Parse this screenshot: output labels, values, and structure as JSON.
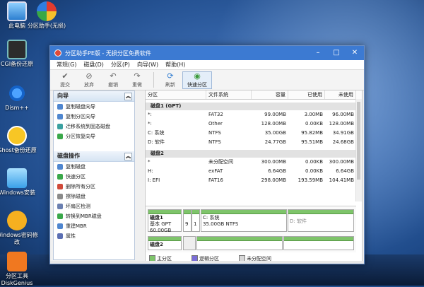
{
  "desktop": {
    "icons": [
      {
        "label": "此电脑",
        "icon": "computer-icon"
      },
      {
        "label": "分区助手(无损)",
        "icon": "partition-assistant-icon"
      },
      {
        "label": "CGI备份还原",
        "icon": "cgi-backup-icon"
      },
      {
        "label": "Dism++",
        "icon": "dism-icon"
      },
      {
        "label": "Ghost备份还原",
        "icon": "ghost-icon"
      },
      {
        "label": "Windows安装",
        "icon": "windows-install-icon"
      },
      {
        "label": "Windows密码修改",
        "icon": "windows-password-icon"
      },
      {
        "label": "分区工具DiskGenius",
        "icon": "diskgenius-icon"
      }
    ]
  },
  "window": {
    "title": "分区助手PE版 - 无损分区免费软件",
    "menu": [
      "常规(G)",
      "磁盘(D)",
      "分区(P)",
      "向导(W)",
      "帮助(H)"
    ],
    "toolbar": [
      {
        "label": "提交",
        "icon": "commit-icon"
      },
      {
        "label": "放弃",
        "icon": "discard-icon"
      },
      {
        "label": "撤销",
        "icon": "undo-icon"
      },
      {
        "label": "重做",
        "icon": "redo-icon"
      },
      {
        "label": "刷新",
        "icon": "refresh-icon"
      },
      {
        "label": "快速分区",
        "icon": "quick-partition-icon"
      }
    ]
  },
  "sidebar": {
    "wizard": {
      "title": "向导",
      "items": [
        "复制磁盘向导",
        "复制分区向导",
        "迁移系统到固态磁盘",
        "分区恢复向导"
      ]
    },
    "disk_ops": {
      "title": "磁盘操作",
      "items": [
        "复制磁盘",
        "快速分区",
        "删除所有分区",
        "擦除磁盘",
        "坏扇区检测",
        "转换到MBR磁盘",
        "重建MBR",
        "属性"
      ]
    }
  },
  "table": {
    "headers": [
      "分区",
      "文件系统",
      "容量",
      "已使用",
      "未使用"
    ],
    "disks": [
      {
        "name": "磁盘1 (GPT)",
        "rows": [
          [
            "*:",
            "FAT32",
            "99.00MB",
            "3.00MB",
            "96.00MB"
          ],
          [
            "*:",
            "Other",
            "128.00MB",
            "0.00KB",
            "128.00MB"
          ],
          [
            "C: 系统",
            "NTFS",
            "35.00GB",
            "95.82MB",
            "34.91GB"
          ],
          [
            "D: 软件",
            "NTFS",
            "24.77GB",
            "95.51MB",
            "24.68GB"
          ]
        ]
      },
      {
        "name": "磁盘2",
        "rows": [
          [
            "*",
            "未分配空间",
            "300.00MB",
            "0.00KB",
            "300.00MB"
          ],
          [
            "H:",
            "exFAT",
            "6.64GB",
            "0.00KB",
            "6.64GB"
          ],
          [
            "I: EFI",
            "FAT16",
            "298.00MB",
            "193.59MB",
            "104.41MB"
          ]
        ]
      }
    ]
  },
  "diskmap": {
    "disk1": {
      "name": "磁盘1",
      "type": "基本 GPT",
      "size": "60.00GB",
      "p1": "9",
      "p2": "1",
      "c_label": "C: 系统",
      "c_info": "35.00GB NTFS",
      "d_label": "D: 软件"
    },
    "disk2": {
      "name": "磁盘2"
    }
  },
  "legend": [
    "主分区",
    "逻辑分区",
    "未分配空间"
  ],
  "colors": {
    "primary": "#7ec46a",
    "logical": "#7b6dd8",
    "unallocated": "#d8d8d8",
    "titlebar": "#3c7ad2"
  }
}
